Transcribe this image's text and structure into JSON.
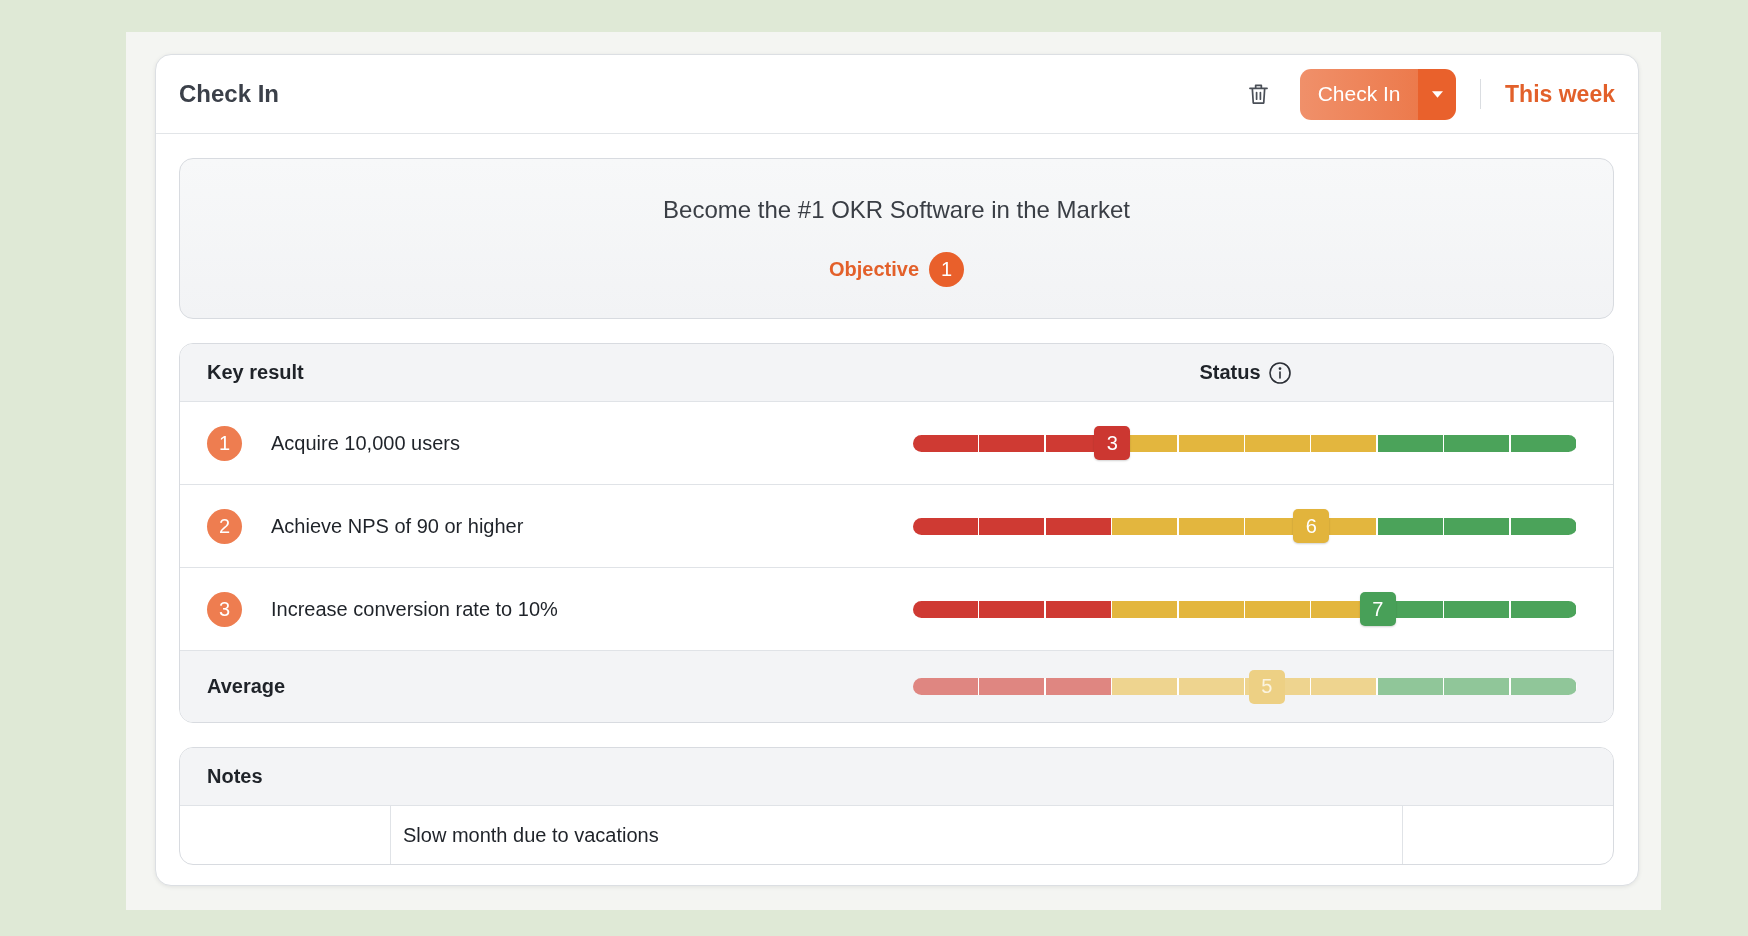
{
  "header": {
    "title": "Check In",
    "button": "Check In",
    "period": "This week"
  },
  "objective": {
    "title": "Become the #1 OKR Software in the Market",
    "label": "Objective",
    "number": "1"
  },
  "key_results": {
    "columns": [
      "Key result",
      "Status"
    ],
    "rows": [
      {
        "number": "1",
        "name": "Acquire 10,000 users",
        "score": "3",
        "level": 0.3,
        "color": "#cc3731"
      },
      {
        "number": "2",
        "name": "Achieve NPS of 90 or higher",
        "score": "6",
        "level": 0.6,
        "color": "#e2b43c"
      },
      {
        "number": "3",
        "name": "Increase conversion rate to 10%",
        "score": "7",
        "level": 0.7,
        "color": "#48a058"
      }
    ],
    "average": {
      "label": "Average",
      "score": "5",
      "level": 0.533,
      "color": "#edd084"
    }
  },
  "notes": {
    "title": "Notes",
    "rows": [
      {
        "text": "Slow month due to vacations"
      }
    ]
  }
}
